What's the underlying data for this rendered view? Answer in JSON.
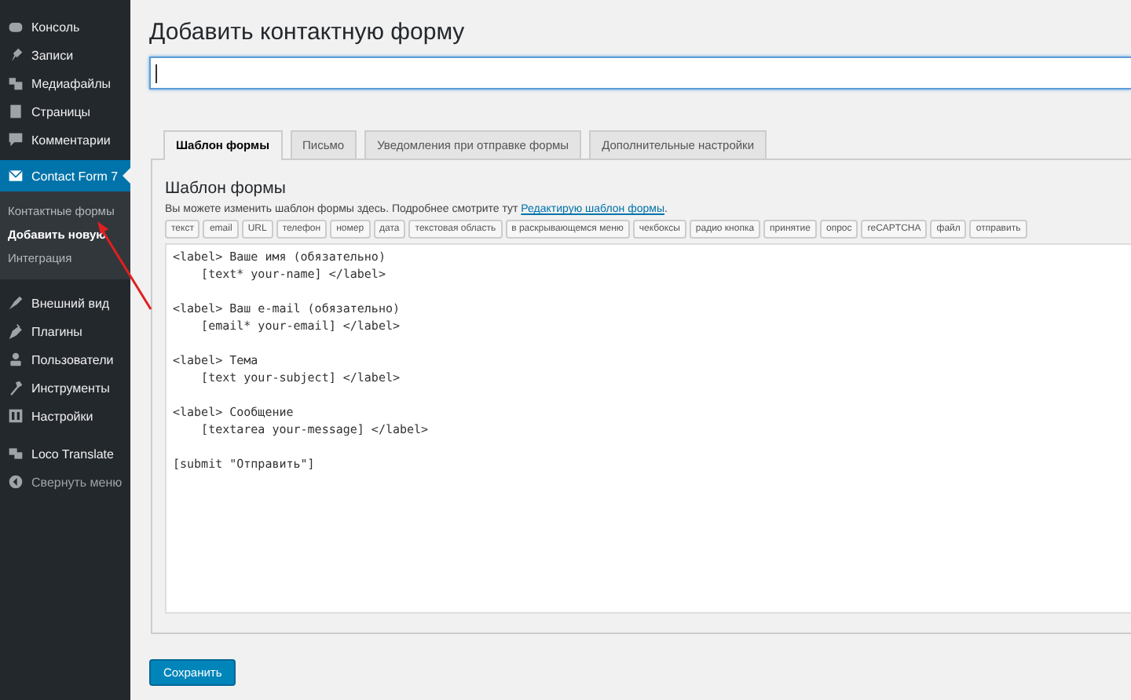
{
  "sidebar": {
    "items": [
      {
        "label": "Консоль",
        "selected": false
      },
      {
        "label": "Записи",
        "selected": false
      },
      {
        "label": "Медиафайлы",
        "selected": false
      },
      {
        "label": "Страницы",
        "selected": false
      },
      {
        "label": "Комментарии",
        "selected": false
      },
      {
        "label": "Contact Form 7",
        "selected": true,
        "children": [
          {
            "label": "Контактные формы",
            "selected": false
          },
          {
            "label": "Добавить новую",
            "selected": true
          },
          {
            "label": "Интеграция",
            "selected": false
          }
        ]
      },
      {
        "label": "Внешний вид",
        "selected": false
      },
      {
        "label": "Плагины",
        "selected": false
      },
      {
        "label": "Пользователи",
        "selected": false
      },
      {
        "label": "Инструменты",
        "selected": false
      },
      {
        "label": "Настройки",
        "selected": false
      },
      {
        "label": "Loco Translate",
        "selected": false
      },
      {
        "label": "Свернуть меню",
        "selected": false
      }
    ]
  },
  "page_title": "Добавить контактную форму",
  "tabs": [
    {
      "label": "Шаблон формы",
      "selected": true
    },
    {
      "label": "Письмо",
      "selected": false
    },
    {
      "label": "Уведомления при отправке формы",
      "selected": false
    },
    {
      "label": "Дополнительные настройки",
      "selected": false
    }
  ],
  "panel": {
    "heading": "Шаблон формы",
    "description": "Вы можете изменить шаблон формы здесь. Подробнее смотрите тут",
    "link": "Редактирую шаблон формы",
    "link_suffix": ".",
    "tag_buttons": [
      "текст",
      "email",
      "URL",
      "телефон",
      "номер",
      "дата",
      "текстовая область",
      "в раскрывающемся меню",
      "чекбоксы",
      "радио кнопка",
      "принятие",
      "опрос",
      "reCAPTCHA",
      "файл",
      "отправить"
    ],
    "template": "<label> Ваше имя (обязательно)\n    [text* your-name] </label>\n\n<label> Ваш e-mail (обязательно)\n    [email* your-email] </label>\n\n<label> Тема\n    [text your-subject] </label>\n\n<label> Сообщение\n    [textarea your-message] </label>\n\n[submit \"Отправить\"]"
  },
  "save_button": "Сохранить"
}
